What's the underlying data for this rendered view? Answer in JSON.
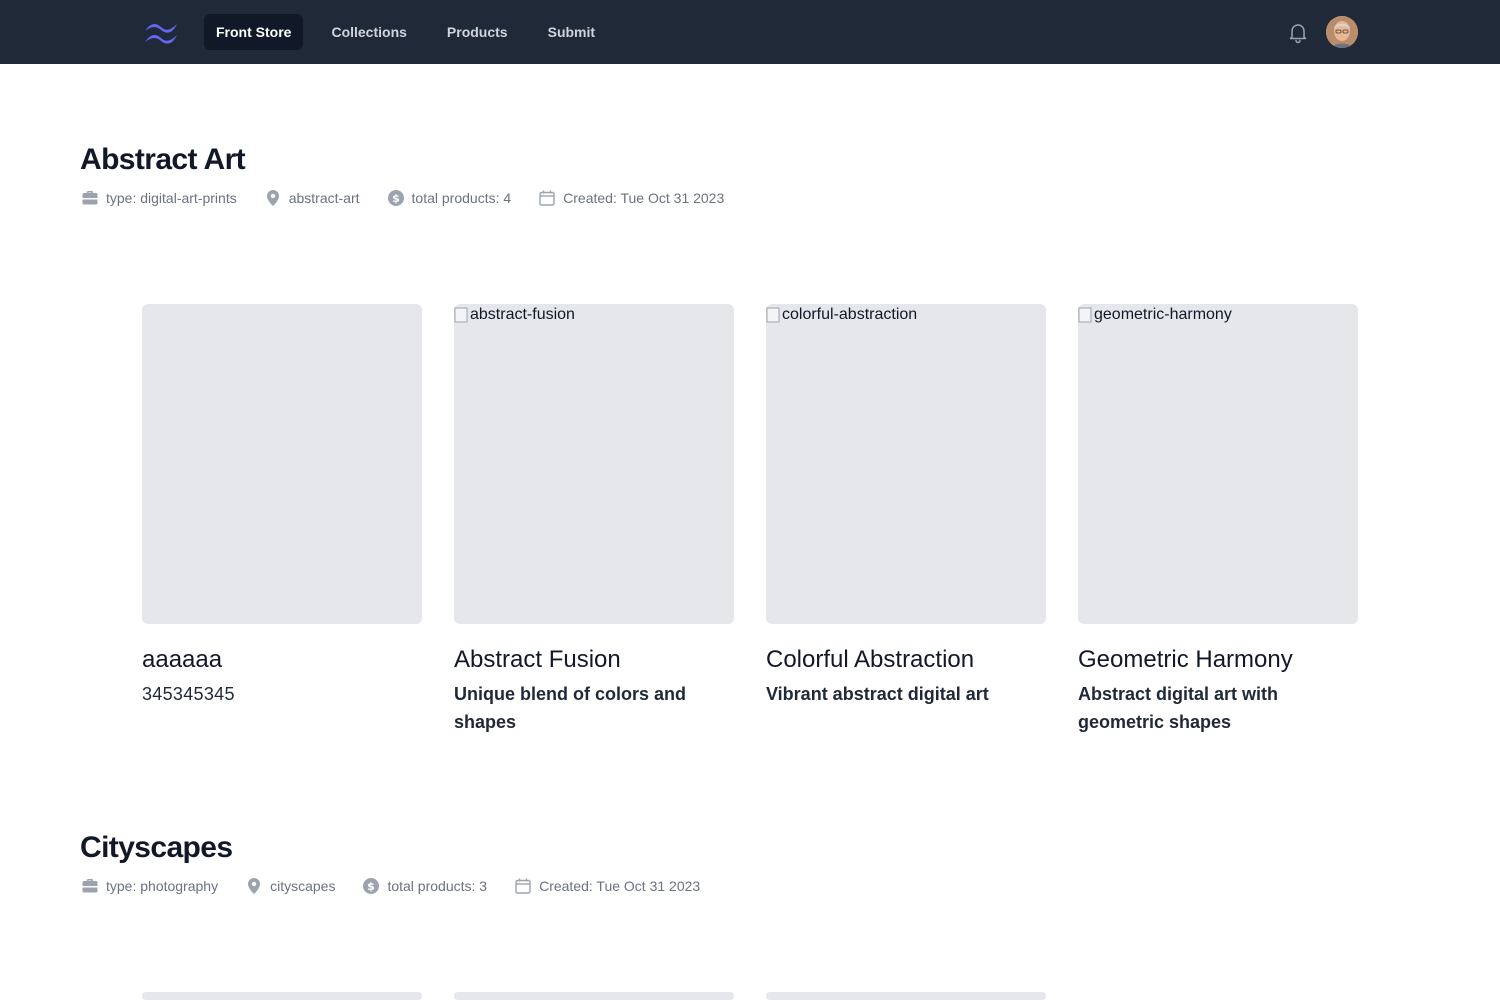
{
  "nav": {
    "items": [
      {
        "label": "Front Store",
        "active": true
      },
      {
        "label": "Collections",
        "active": false
      },
      {
        "label": "Products",
        "active": false
      },
      {
        "label": "Submit",
        "active": false
      }
    ]
  },
  "icons": {
    "logo": "tailwind-logo-icon",
    "notifications": "bell-icon",
    "type": "briefcase-icon",
    "slug": "location-pin-icon",
    "total": "dollar-circle-icon",
    "created": "calendar-icon"
  },
  "colors": {
    "nav_bg": "#1f2937",
    "nav_active_bg": "#111827",
    "logo": "#6366f1",
    "image_placeholder": "#e5e7eb",
    "meta_text": "#6b7280"
  },
  "collections": [
    {
      "title": "Abstract Art",
      "meta": {
        "type": "type: digital-art-prints",
        "slug": "abstract-art",
        "total": "total products: 4",
        "created": "Created: Tue Oct 31 2023"
      },
      "products": [
        {
          "image_alt": "",
          "name": "aaaaaa",
          "description": "345345345"
        },
        {
          "image_alt": "abstract-fusion",
          "name": "Abstract Fusion",
          "description": "Unique blend of colors and shapes"
        },
        {
          "image_alt": "colorful-abstraction",
          "name": "Colorful Abstraction",
          "description": "Vibrant abstract digital art"
        },
        {
          "image_alt": "geometric-harmony",
          "name": "Geometric Harmony",
          "description": "Abstract digital art with geometric shapes"
        }
      ]
    },
    {
      "title": "Cityscapes",
      "meta": {
        "type": "type: photography",
        "slug": "cityscapes",
        "total": "total products: 3",
        "created": "Created: Tue Oct 31 2023"
      }
    }
  ]
}
